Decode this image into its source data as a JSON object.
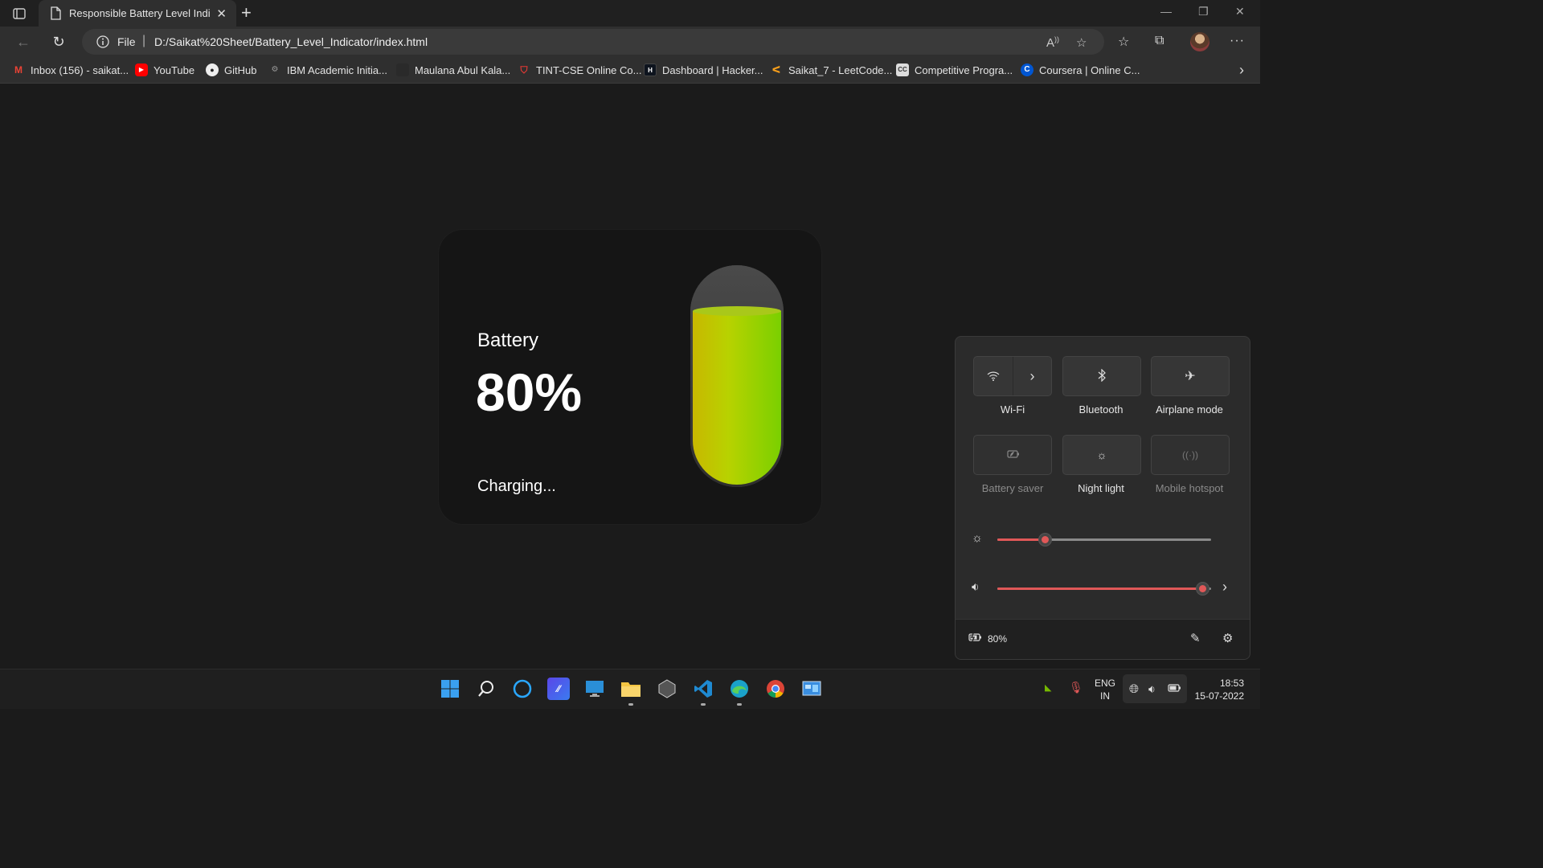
{
  "browser": {
    "tab_title": "Responsible Battery Level Indicat",
    "address_scheme": "File",
    "address_url": "D:/Saikat%20Sheet/Battery_Level_Indicator/index.html"
  },
  "bookmarks": [
    {
      "label": "Inbox (156) - saikat...",
      "icon": "gmail-icon",
      "color": "#ea4335"
    },
    {
      "label": "YouTube",
      "icon": "youtube-icon",
      "color": "#ff0000"
    },
    {
      "label": "GitHub",
      "icon": "github-icon",
      "color": "#ffffff"
    },
    {
      "label": "IBM Academic Initia...",
      "icon": "ibm-icon",
      "color": "#888888"
    },
    {
      "label": "Maulana Abul Kala...",
      "icon": "generic-site-icon",
      "color": "#333333"
    },
    {
      "label": "TINT-CSE Online Co...",
      "icon": "shield-icon",
      "color": "#d32f2f"
    },
    {
      "label": "Dashboard | Hacker...",
      "icon": "hackerrank-icon",
      "color": "#111111"
    },
    {
      "label": "Saikat_7 - LeetCode...",
      "icon": "leetcode-icon",
      "color": "#f89f1b"
    },
    {
      "label": "Competitive Progra...",
      "icon": "codechef-icon",
      "color": "#cccccc"
    },
    {
      "label": "Coursera | Online C...",
      "icon": "coursera-icon",
      "color": "#0056d2"
    }
  ],
  "battery_card": {
    "label": "Battery",
    "percent_text": "80%",
    "level": 0.8,
    "status": "Charging..."
  },
  "quick_settings": {
    "tiles": [
      {
        "label": "Wi-Fi",
        "icon": "wifi-icon",
        "active": true
      },
      {
        "label": "Bluetooth",
        "icon": "bluetooth-icon",
        "active": true
      },
      {
        "label": "Airplane mode",
        "icon": "airplane-icon",
        "active": true
      },
      {
        "label": "Battery saver",
        "icon": "battery-saver-icon",
        "active": false
      },
      {
        "label": "Night light",
        "icon": "night-light-icon",
        "active": true
      },
      {
        "label": "Mobile hotspot",
        "icon": "hotspot-icon",
        "active": false
      }
    ],
    "brightness": 0.22,
    "volume": 0.96,
    "battery_text": "80%"
  },
  "taskbar": {
    "language_line1": "ENG",
    "language_line2": "IN",
    "time": "18:53",
    "date": "15-07-2022"
  },
  "colors": {
    "accent": "#e05858",
    "battery_fill_left": "#c8b800",
    "battery_fill_right": "#7ad000"
  }
}
